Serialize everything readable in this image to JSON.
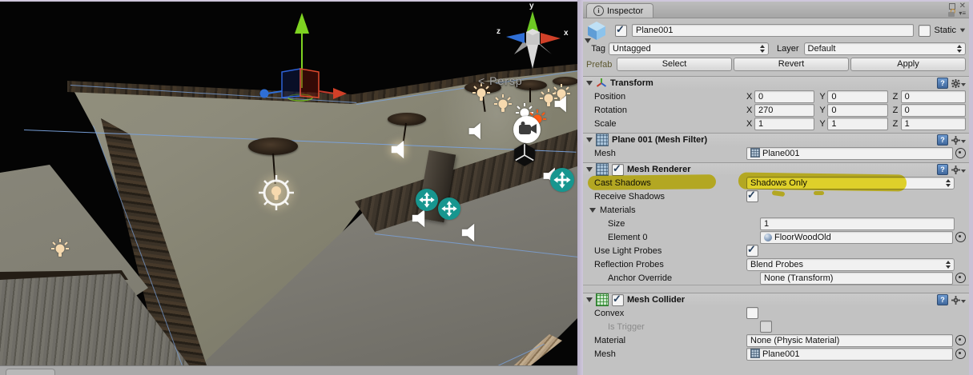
{
  "window": {
    "tab_title": "Inspector"
  },
  "scene": {
    "persp_label": "< Persp",
    "axis_gizmo": {
      "x": "x",
      "y": "y",
      "z": "z"
    },
    "gizmos": [
      "light-gizmo",
      "audio-source-gizmo",
      "camera-gizmo",
      "unity-logo-gizmo",
      "move-gizmo",
      "teal-move-gizmo"
    ]
  },
  "inspector": {
    "header": {
      "name": "Plane001",
      "static_label": "Static",
      "tag_label": "Tag",
      "tag_value": "Untagged",
      "layer_label": "Layer",
      "layer_value": "Default",
      "prefab_label": "Prefab",
      "prefab_buttons": [
        "Select",
        "Revert",
        "Apply"
      ]
    },
    "transform": {
      "title": "Transform",
      "axis_labels": {
        "x": "X",
        "y": "Y",
        "z": "Z"
      },
      "rows": [
        {
          "label": "Position",
          "x": "0",
          "y": "0",
          "z": "0"
        },
        {
          "label": "Rotation",
          "x": "270",
          "y": "0",
          "z": "0"
        },
        {
          "label": "Scale",
          "x": "1",
          "y": "1",
          "z": "1"
        }
      ]
    },
    "mesh_filter": {
      "title": "Plane 001 (Mesh Filter)",
      "mesh_label": "Mesh",
      "mesh_value": "Plane001"
    },
    "mesh_renderer": {
      "title": "Mesh Renderer",
      "cast_shadows_label": "Cast Shadows",
      "cast_shadows_value": "Shadows Only",
      "receive_shadows_label": "Receive Shadows",
      "materials_label": "Materials",
      "size_label": "Size",
      "size_value": "1",
      "element0_label": "Element 0",
      "element0_value": "FloorWoodOld",
      "use_light_probes_label": "Use Light Probes",
      "reflection_probes_label": "Reflection Probes",
      "reflection_probes_value": "Blend Probes",
      "anchor_override_label": "Anchor Override",
      "anchor_override_value": "None (Transform)"
    },
    "mesh_collider": {
      "title": "Mesh Collider",
      "convex_label": "Convex",
      "is_trigger_label": "Is Trigger",
      "material_label": "Material",
      "material_value": "None (Physic Material)",
      "mesh_label": "Mesh",
      "mesh_value": "Plane001"
    }
  },
  "colors": {
    "highlight_marker": "#e8d606",
    "gizmo_teal": "#17968f",
    "axis_x_red": "#d04028",
    "axis_y_green": "#7ed321",
    "axis_z_blue": "#2f6fd6",
    "selection_wireframe": "#7aa2dc",
    "panel_bg": "#c2c2c2"
  }
}
